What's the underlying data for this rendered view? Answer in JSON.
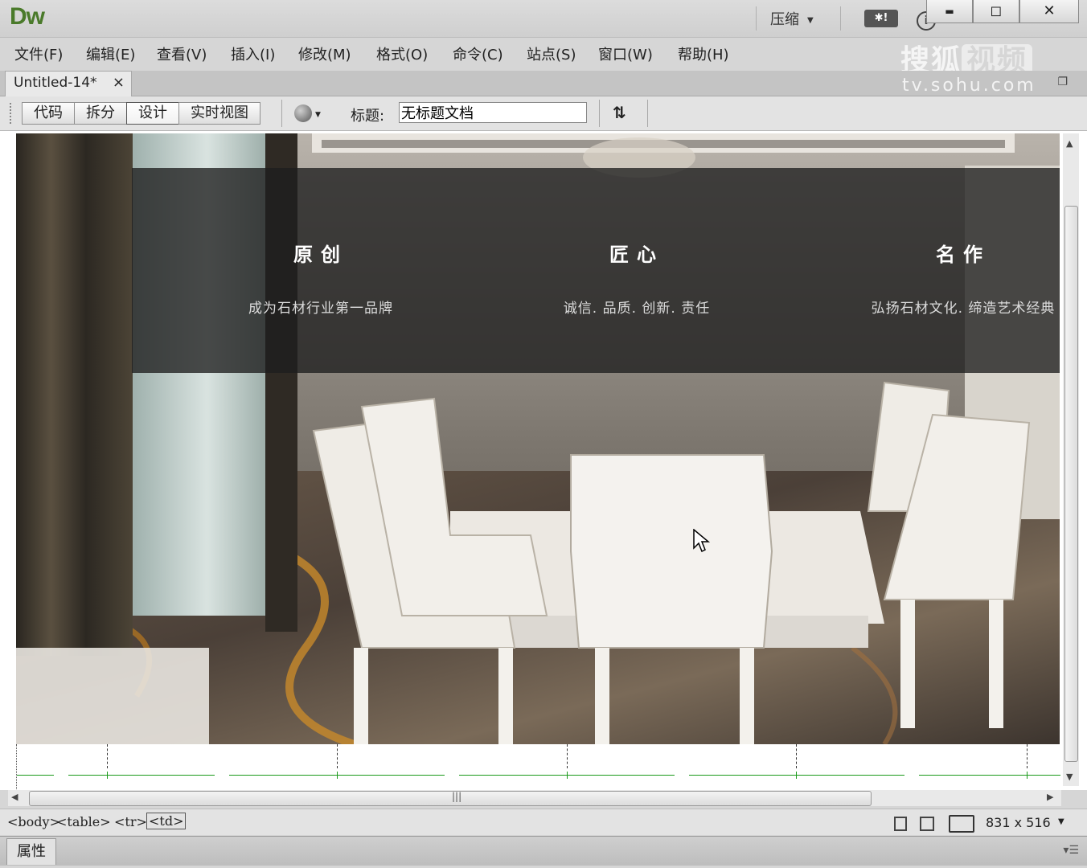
{
  "app": {
    "logo": "Dw",
    "workspace": "压缩",
    "cs_live": "✱!",
    "info": "i"
  },
  "window_controls": {
    "minimize": "▬",
    "maximize": "◻",
    "close": "✕"
  },
  "menu": [
    "文件(F)",
    "编辑(E)",
    "查看(V)",
    "插入(I)",
    "修改(M)",
    "格式(O)",
    "命令(C)",
    "站点(S)",
    "窗口(W)",
    "帮助(H)"
  ],
  "watermark": {
    "brand": "搜狐",
    "brand_box": "视频",
    "url": "tv.sohu.com"
  },
  "doc_tab": {
    "name": "Untitled-14*",
    "close": "×"
  },
  "toolbar": {
    "views": [
      "代码",
      "拆分",
      "设计",
      "实时视图"
    ],
    "active_view": "设计",
    "title_label": "标题:",
    "title_value": "无标题文档"
  },
  "page": {
    "features": [
      {
        "heading": "原创",
        "subtitle": "成为石材行业第一品牌"
      },
      {
        "heading": "匠心",
        "subtitle": "诚信. 品质. 创新. 责任"
      },
      {
        "heading": "名作",
        "subtitle": "弘扬石材文化. 缔造艺术经典"
      }
    ]
  },
  "status": {
    "tags": [
      "<body>",
      "<table>",
      "<tr>",
      "<td>"
    ],
    "selected_tag": "<td>",
    "window_size": "831 x 516"
  },
  "properties_panel": {
    "tab": "属性"
  },
  "colors": {
    "accent_green": "#4a7a2a",
    "overlay": "#1e1e1e",
    "guide_green": "#1a9a1a"
  }
}
